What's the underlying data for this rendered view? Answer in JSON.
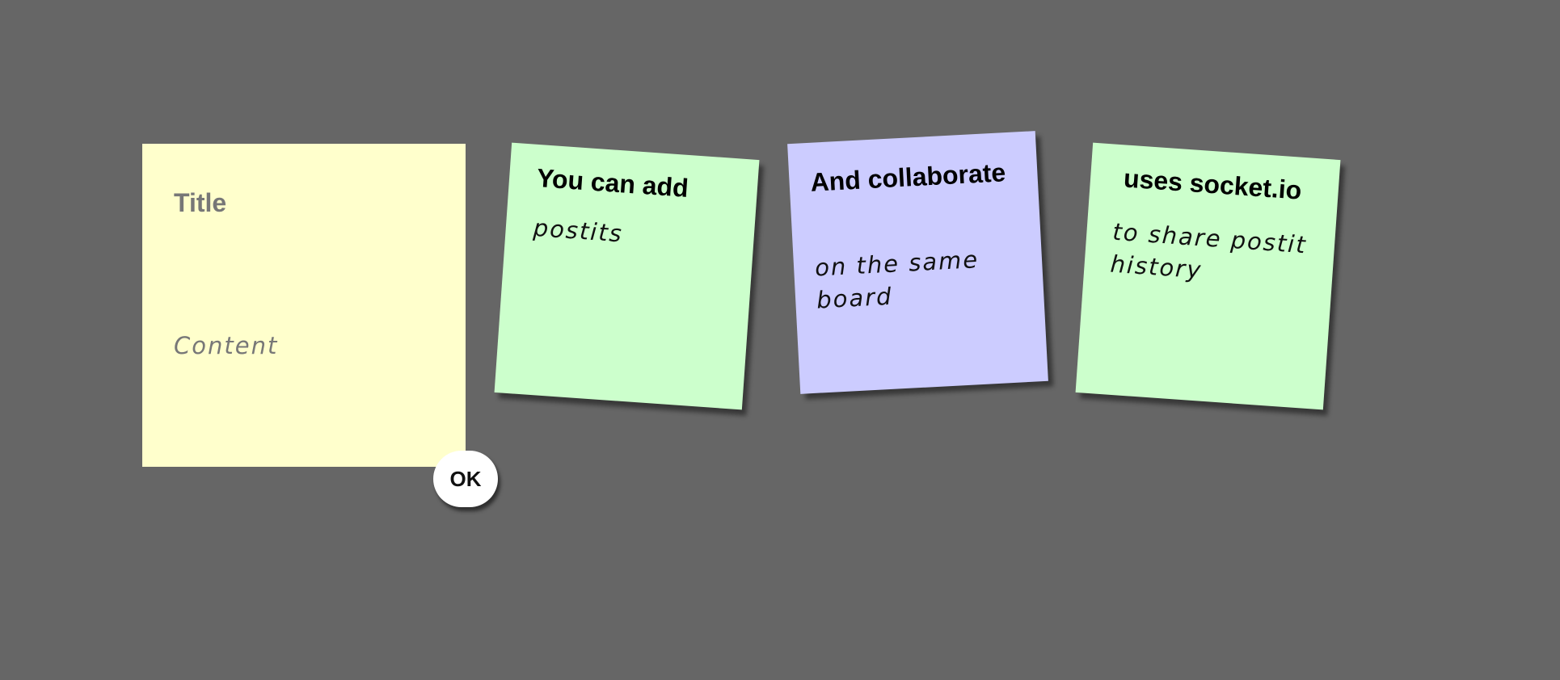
{
  "editor": {
    "title_placeholder": "Title",
    "content_placeholder": "Content",
    "color": "#ffffcc",
    "ok_label": "OK"
  },
  "postits": [
    {
      "title": "You can add",
      "content": "postits",
      "color": "#ccffcc"
    },
    {
      "title": "And collaborate",
      "content": "on the same board",
      "color": "#ccccff"
    },
    {
      "title": "uses socket.io",
      "content": "to share postit history",
      "color": "#ccffcc"
    }
  ],
  "board": {
    "background": "#666666"
  }
}
